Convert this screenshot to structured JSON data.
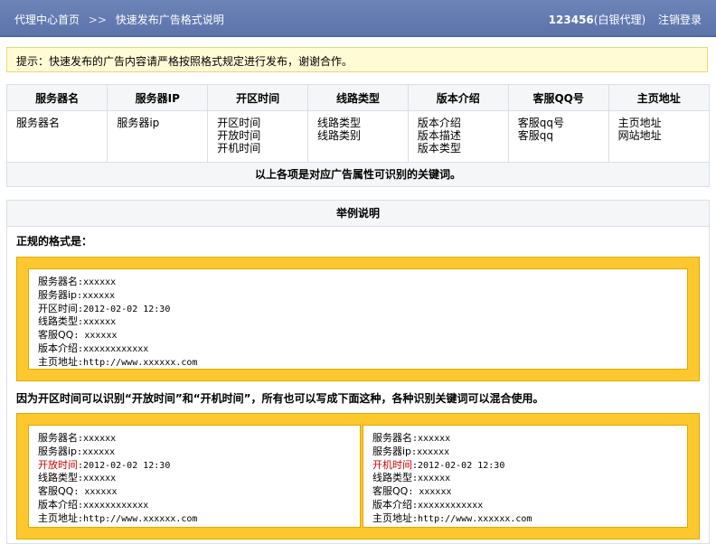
{
  "header": {
    "home_link": "代理中心首页",
    "separator": ">>",
    "current_page": "快速发布广告格式说明",
    "user_id": "123456",
    "user_level": "(白银代理)",
    "logout": "注销登录"
  },
  "notice": "提示：快速发布的广告内容请严格按照格式规定进行发布，谢谢合作。",
  "keywords_table": {
    "headers": [
      "服务器名",
      "服务器IP",
      "开区时间",
      "线路类型",
      "版本介绍",
      "客服QQ号",
      "主页地址"
    ],
    "cells": [
      [
        "服务器名"
      ],
      [
        "服务器ip"
      ],
      [
        "开区时间",
        "开放时间",
        "开机时间"
      ],
      [
        "线路类型",
        "线路类别"
      ],
      [
        "版本介绍",
        "版本描述",
        "版本类型"
      ],
      [
        "客服qq号",
        "客服qq"
      ],
      [
        "主页地址",
        "网站地址"
      ]
    ],
    "note": "以上各项是对应广告属性可识别的关键词。"
  },
  "example": {
    "title": "举例说明",
    "label1": "正规的格式是：",
    "sample1": [
      {
        "key": "服务器名",
        "sep": ":",
        "val": "xxxxxx"
      },
      {
        "key": "服务器ip",
        "sep": ":",
        "val": "xxxxxx"
      },
      {
        "key": "开区时间",
        "sep": ":",
        "val": "2012-02-02 12:30"
      },
      {
        "key": "线路类型",
        "sep": ":",
        "val": "xxxxxx"
      },
      {
        "key": "客服QQ",
        "sep": ": ",
        "val": "xxxxxx"
      },
      {
        "key": "版本介绍",
        "sep": ":",
        "val": "xxxxxxxxxxxx"
      },
      {
        "key": "主页地址",
        "sep": ":",
        "val": "http://www.xxxxxx.com"
      }
    ],
    "label2": "因为开区时间可以识别“开放时间”和“开机时间”，所有也可以写成下面这种，各种识别关键词可以混合使用。",
    "sample2a": [
      {
        "key": "服务器名",
        "sep": ":",
        "val": "xxxxxx"
      },
      {
        "key": "服务器ip",
        "sep": ":",
        "val": "xxxxxx"
      },
      {
        "key": "开放时间",
        "sep": ":",
        "val": "2012-02-02 12:30"
      },
      {
        "key": "线路类型",
        "sep": ":",
        "val": "xxxxxx"
      },
      {
        "key": "客服QQ",
        "sep": ": ",
        "val": "xxxxxx"
      },
      {
        "key": "版本介绍",
        "sep": ":",
        "val": "xxxxxxxxxxxx"
      },
      {
        "key": "主页地址",
        "sep": ":",
        "val": "http://www.xxxxxx.com"
      }
    ],
    "sample2b": [
      {
        "key": "服务器名",
        "sep": ":",
        "val": "xxxxxx"
      },
      {
        "key": "服务器ip",
        "sep": ":",
        "val": "xxxxxx"
      },
      {
        "key": "开机时间",
        "sep": ":",
        "val": "2012-02-02 12:30"
      },
      {
        "key": "线路类型",
        "sep": ":",
        "val": "xxxxxx"
      },
      {
        "key": "客服QQ",
        "sep": ": ",
        "val": "xxxxxx"
      },
      {
        "key": "版本介绍",
        "sep": ":",
        "val": "xxxxxxxxxxxx"
      },
      {
        "key": "主页地址",
        "sep": ":",
        "val": "http://www.xxxxxx.com"
      }
    ],
    "highlight_color": "#cc0000"
  },
  "colors": {
    "header_bg": "#5b73aa",
    "notice_bg": "#fffbd5",
    "frame_yellow": "#fcc82e"
  }
}
